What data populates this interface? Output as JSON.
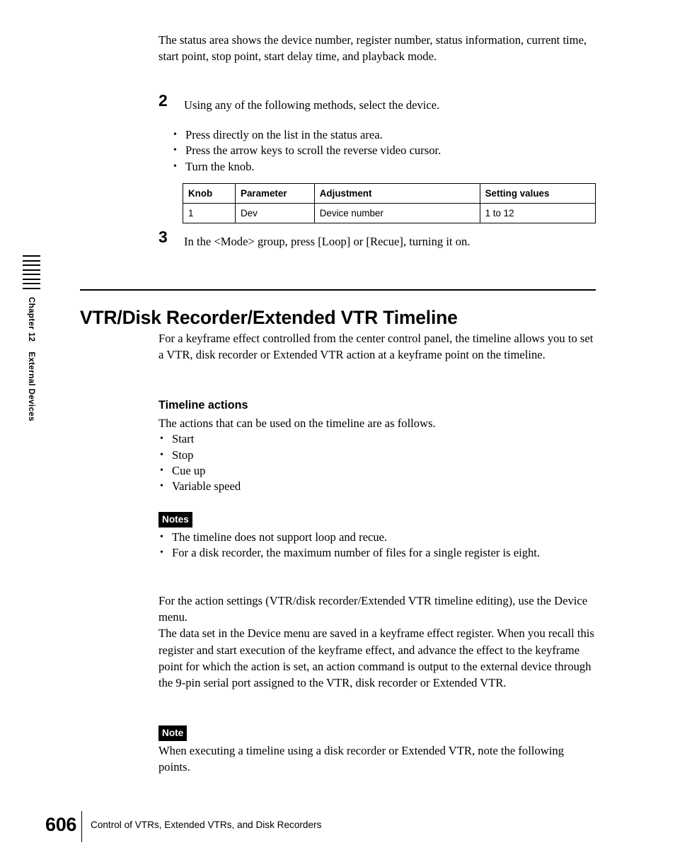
{
  "chapter_tab": {
    "chapter": "Chapter 12",
    "section": "External Devices",
    "stripe_count": 8
  },
  "intro": {
    "paragraph": "The status area shows the device number, register number, status information, current time, start point, stop point, start delay time, and playback mode."
  },
  "steps": [
    {
      "number": "2",
      "text": "Using any of the following methods, select the device.",
      "bullets": [
        "Press directly on the list in the status area.",
        "Press the arrow keys to scroll the reverse video cursor.",
        "Turn the knob."
      ]
    },
    {
      "number": "3",
      "text": "In the <Mode> group, press [Loop] or [Recue], turning it on.",
      "bullets": []
    }
  ],
  "knob_table": {
    "headers": [
      "Knob",
      "Parameter",
      "Adjustment",
      "Setting values"
    ],
    "rows": [
      [
        "1",
        "Dev",
        "Device number",
        "1 to 12"
      ]
    ]
  },
  "section": {
    "title": "VTR/Disk Recorder/Extended VTR Timeline",
    "intro": "For a keyframe effect controlled from the center control panel, the timeline allows you to set a VTR, disk recorder or Extended VTR action at a keyframe point on the timeline."
  },
  "timeline_actions": {
    "heading": "Timeline actions",
    "lead": "The actions that can be used on the timeline are as follows.",
    "items": [
      "Start",
      "Stop",
      "Cue up",
      "Variable speed"
    ]
  },
  "notes_block": {
    "badge": "Notes",
    "items": [
      "The timeline does not support loop and recue.",
      "For a disk recorder, the maximum number of files for a single register is eight."
    ]
  },
  "action_settings": {
    "paragraph_1": "For the action settings (VTR/disk recorder/Extended VTR timeline editing), use the Device menu.",
    "paragraph_2": "The data set in the Device menu are saved in a keyframe effect register. When you recall this register and start execution of the keyframe effect, and advance the effect to the keyframe point for which the action is set, an action command is output to the external device through the 9-pin serial port assigned to the VTR, disk recorder or Extended VTR."
  },
  "note_block": {
    "badge": "Note",
    "text": "When executing a timeline using a disk recorder or Extended VTR, note the following points."
  },
  "footer": {
    "page_number": "606",
    "running_title": "Control of VTRs, Extended VTRs, and Disk Recorders"
  }
}
